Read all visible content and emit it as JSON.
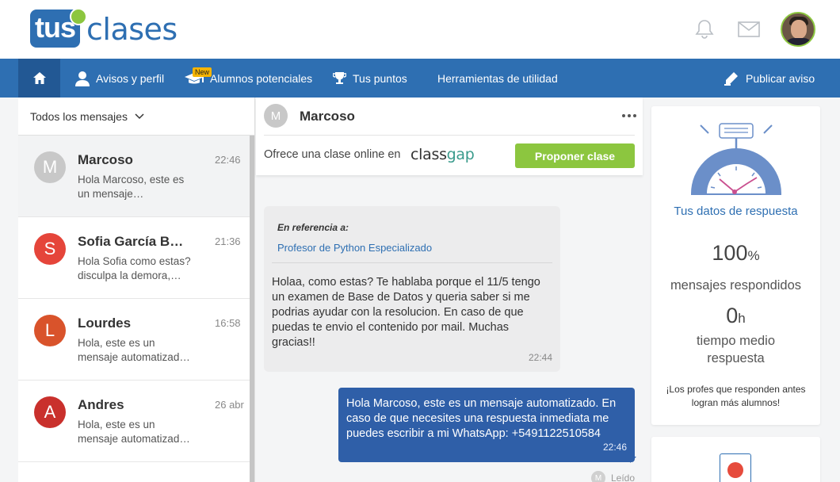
{
  "header": {
    "logo": {
      "part1": "tus",
      "part2": "clases"
    },
    "icons": [
      "bell-icon",
      "mail-icon"
    ],
    "avatar": "user-avatar"
  },
  "nav": {
    "home_icon": "home-icon",
    "items": [
      {
        "label": "Avisos y perfil",
        "icon": "user-icon"
      },
      {
        "label": "Alumnos potenciales",
        "icon": "graduation-cap-icon",
        "badge": "New"
      },
      {
        "label": "Tus puntos",
        "icon": "trophy-icon"
      },
      {
        "label": "Herramientas de utilidad"
      },
      {
        "label": "Publicar aviso",
        "icon": "pencil-icon"
      }
    ]
  },
  "inbox": {
    "filter_label": "Todos los mensajes",
    "conversations": [
      {
        "initial": "M",
        "name": "Marcoso",
        "time": "22:46",
        "preview": "Hola Marcoso, este es un mensaje…",
        "color": "#c8c8c8",
        "active": true
      },
      {
        "initial": "S",
        "name": "Sofia García B…",
        "time": "21:36",
        "preview": "Hola Sofia como estas? disculpa la demora,…",
        "color": "#e5453a"
      },
      {
        "initial": "L",
        "name": "Lourdes",
        "time": "16:58",
        "preview": "Hola, este es un mensaje automatizad…",
        "color": "#d9532b"
      },
      {
        "initial": "A",
        "name": "Andres",
        "time": "26 abr",
        "preview": "Hola, este es un mensaje automatizad…",
        "color": "#c9302c"
      }
    ]
  },
  "chat": {
    "contact_initial": "M",
    "contact_name": "Marcoso",
    "offer_text": "Ofrece una clase online en",
    "offer_brand": {
      "part1": "class",
      "part2": "gap"
    },
    "propose_button": "Proponer clase",
    "incoming": {
      "ref_heading": "En referencia a:",
      "ref_link": "Profesor de Python Especializado",
      "text": "Holaa, como estas? Te hablaba porque el 11/5 tengo un examen de Base de Datos y queria saber si me podrias ayudar con la resolucion. En caso de que puedas te envio el contenido por mail. Muchas gracias!!",
      "time": "22:44"
    },
    "outgoing": {
      "text": "Hola Marcoso, este es un mensaje automatizado. En caso de que necesites una respuesta inmediata me puedes escribir a mi WhatsApp: +5491122510584",
      "time": "22:46",
      "read_initial": "M",
      "read_label": "Leído"
    }
  },
  "stats": {
    "title": "Tus datos de respuesta",
    "response_pct": "100",
    "response_pct_unit": "%",
    "response_label": "mensajes respondidos",
    "avg_time": "0",
    "avg_time_unit": "h",
    "avg_time_label": "tiempo medio respuesta",
    "note": "¡Los profes que responden antes logran más alumnos!"
  },
  "colors": {
    "brand_blue": "#2e6fb2",
    "brand_green": "#8cc63f",
    "outgoing_bubble": "#2f5fa8"
  }
}
